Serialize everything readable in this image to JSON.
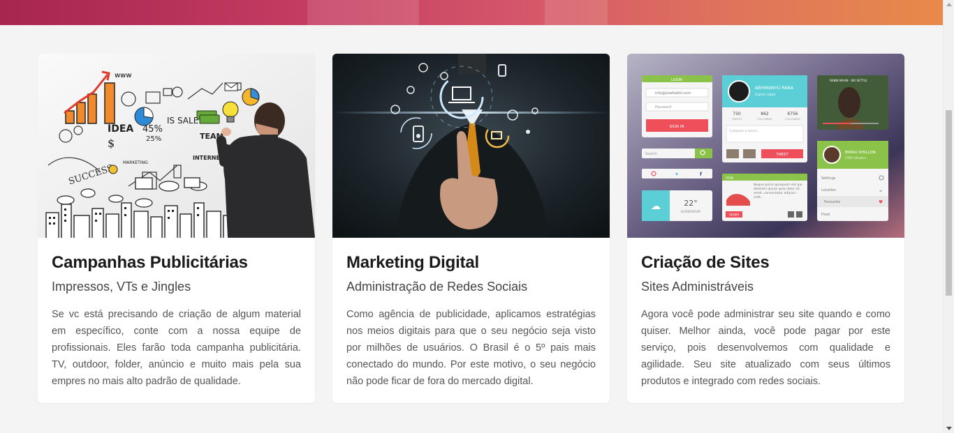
{
  "cards": [
    {
      "title": "Campanhas Publicitárias",
      "subtitle": "Impressos, VTs e Jingles",
      "text": "Se vc está precisando de criação de algum material em específico, conte com a nossa equipe de profissionais. Eles farão toda campanha publicitária. TV, outdoor, folder, anúncio e muito mais pela sua empres no mais alto padrão de qualidade.",
      "image": {
        "label_idea": "IDEA",
        "label_sale": "IS SALE!",
        "label_team": "TEAM",
        "label_www": "www",
        "label_success": "SUCCESS",
        "label_marketing": "MARKETING",
        "label_internet": "INTERNET",
        "label_pct": "45%",
        "label_25": "25%"
      }
    },
    {
      "title": "Marketing Digital",
      "subtitle": "Administração de Redes Sociais",
      "text": "Como agência de publicidade, aplicamos estratégias nos meios digitais para que o seu negócio seja visto por milhões de usuários. O Brasil é o 5º pais mais conectado do mundo. Por este motivo, o seu negócio não pode ficar de fora do mercado digital."
    },
    {
      "title": "Criação de Sites",
      "subtitle": "Sites Administráveis",
      "text": "Agora você pode administrar seu site quando e como quiser. Melhor ainda, você pode pagar por este serviço, pois desenvolvemos com qualidade e agilidade. Seu site atualizado com seus últimos produtos e integrado com redes sociais.",
      "image": {
        "login_title": "LOGIN",
        "login_email": "info@pixeltabhi.com",
        "login_password": "Password",
        "login_button": "SIGN IN",
        "search_placeholder": "Search",
        "profile_name": "ABHIMANYU RANA",
        "profile_role": "Digital rabbit",
        "stat1": "750",
        "stat1_label": "TWEETS",
        "stat2": "862",
        "stat2_label": "FOLLOWING",
        "stat3": "6756",
        "stat3_label": "FOLLOWERS",
        "compose_placeholder": "Compose a tweet...",
        "tweet_button": "TWEET",
        "weather_temp": "22°",
        "weather_city": "GURDASPUR",
        "item_title": "ITEM",
        "item_text": "Neque porro quisquam est qui dolorem ipsum quia dolor sit amet, consectetur adipisci velit...",
        "order_button": "ORDER",
        "video_caption": "RABBI MAAN - NO SETTLE",
        "user_name": "BINNU DHILLON",
        "user_sub": "3780 Followers",
        "menu": [
          "Settings",
          "Location",
          "Favourite",
          "Food"
        ]
      }
    }
  ],
  "colors": {
    "accent_green": "#8bc34a",
    "accent_red": "#ef4f5b",
    "teal": "#5ccfd6"
  }
}
